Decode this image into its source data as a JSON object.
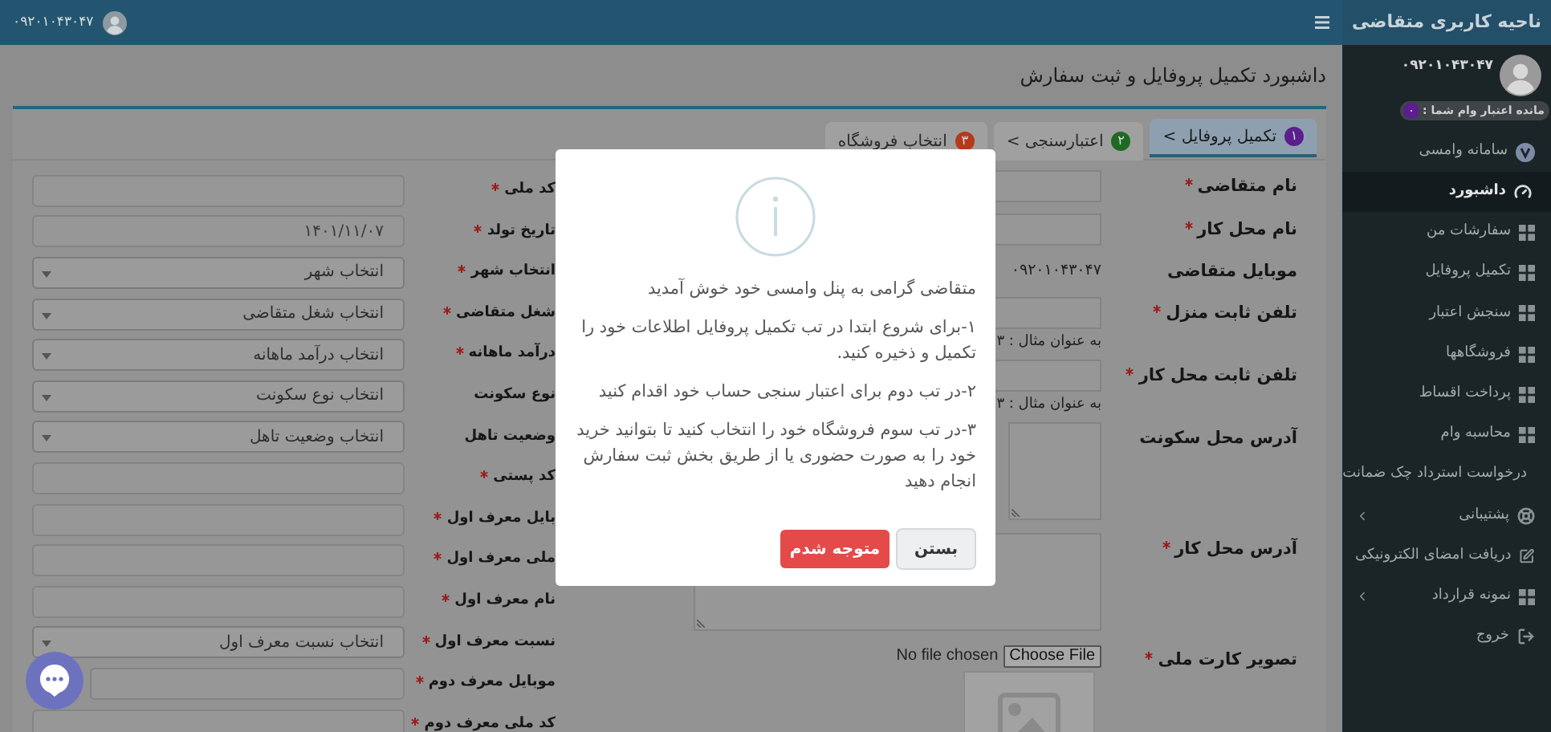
{
  "header": {
    "user_phone": "۰۹۲۰۱۰۴۳۰۴۷"
  },
  "sidebar": {
    "title": "ناحیه کاربری متقاضی",
    "user_phone": "۰۹۲۰۱۰۴۳۰۴۷",
    "credit_label": "مانده اعتبار وام شما :",
    "credit_value": "۰",
    "items": [
      {
        "label": "سامانه وامسی",
        "selected": false,
        "has_submenu": false
      },
      {
        "label": "داشبورد",
        "selected": true,
        "has_submenu": false
      },
      {
        "label": "سفارشات من",
        "selected": false,
        "has_submenu": false
      },
      {
        "label": "تکمیل پروفایل",
        "selected": false,
        "has_submenu": false
      },
      {
        "label": "سنجش اعتبار",
        "selected": false,
        "has_submenu": false
      },
      {
        "label": "فروشگاهها",
        "selected": false,
        "has_submenu": false
      },
      {
        "label": "پرداخت اقساط",
        "selected": false,
        "has_submenu": false
      },
      {
        "label": "محاسبه وام",
        "selected": false,
        "has_submenu": false
      },
      {
        "label": "درخواست استرداد چک ضمانت",
        "selected": false,
        "has_submenu": false
      },
      {
        "label": "پشتیبانی",
        "selected": false,
        "has_submenu": true
      },
      {
        "label": "دریافت امضای الکترونیکی",
        "selected": false,
        "has_submenu": false
      },
      {
        "label": "نمونه قرارداد",
        "selected": false,
        "has_submenu": true
      },
      {
        "label": "خروج",
        "selected": false,
        "has_submenu": false
      }
    ]
  },
  "page_title": "داشبورد تکمیل پروفایل و ثبت سفارش",
  "tabs": [
    {
      "label": "تکمیل پروفایل >",
      "badge": "۱",
      "color": "#5a1f8c",
      "selected": true
    },
    {
      "label": "اعتبارسنجی >",
      "badge": "۲",
      "color": "#1f6a22",
      "selected": false
    },
    {
      "label": "انتخاب فروشگاه",
      "badge": "۳",
      "color": "#b33a1c",
      "selected": false
    }
  ],
  "right_fields": [
    {
      "label": "نام متقاضی",
      "required": true,
      "kind": "input"
    },
    {
      "label": "نام محل کار",
      "required": true,
      "kind": "input"
    },
    {
      "label": "موبایل متقاضی",
      "required": false,
      "kind": "static",
      "value": "۰۹۲۰۱۰۴۳۰۴۷"
    },
    {
      "label": "تلفن ثابت منزل",
      "required": true,
      "kind": "input",
      "hint": "به عنوان مثال : ۳"
    },
    {
      "label": "تلفن ثابت محل کار",
      "required": true,
      "kind": "input",
      "hint": "به عنوان مثال : ۳"
    },
    {
      "label": "آدرس محل سکونت",
      "required": false,
      "kind": "textarea"
    },
    {
      "label": "آدرس محل کار",
      "required": true,
      "kind": "textarea"
    },
    {
      "label": "تصویر کارت ملی",
      "required": true,
      "kind": "file",
      "status": "No file chosen",
      "button": "Choose File"
    }
  ],
  "left_fields": [
    {
      "label": "کد ملی",
      "required": true,
      "kind": "input"
    },
    {
      "label": "تاریخ تولد",
      "required": true,
      "kind": "input",
      "value": "۱۴۰۱/۱۱/۰۷"
    },
    {
      "label": "انتخاب شهر",
      "required": true,
      "kind": "select",
      "value": "انتخاب شهر"
    },
    {
      "label": "شغل متقاضی",
      "required": true,
      "kind": "select",
      "value": "انتخاب شغل متقاضی"
    },
    {
      "label": "درآمد ماهانه",
      "required": true,
      "kind": "select",
      "value": "انتخاب درآمد ماهانه"
    },
    {
      "label": "نوع سکونت",
      "required": false,
      "kind": "select",
      "value": "انتخاب نوع سکونت"
    },
    {
      "label": "وضعیت تاهل",
      "required": false,
      "kind": "select",
      "value": "انتخاب وضعیت تاهل"
    },
    {
      "label": "کد پستی",
      "required": true,
      "kind": "input"
    },
    {
      "label": "بایل معرف اول",
      "required": true,
      "kind": "input"
    },
    {
      "label": "ملی معرف اول",
      "required": true,
      "kind": "input"
    },
    {
      "label": "نام معرف اول",
      "required": true,
      "kind": "input"
    },
    {
      "label": "نسبت معرف اول",
      "required": true,
      "kind": "select",
      "value": "انتخاب نسبت معرف اول"
    },
    {
      "label": "موبایل معرف دوم",
      "required": true,
      "kind": "input"
    },
    {
      "label": "کد ملی معرف دوم",
      "required": true,
      "kind": "input"
    }
  ],
  "modal": {
    "welcome": "متقاضی گرامی به پنل وامسی خود خوش آمدید",
    "steps": [
      "۱-برای شروع ابتدا در تب تکمیل پروفایل اطلاعات خود را تکمیل و ذخیره کنید.",
      "۲-در تب دوم برای اعتبار سنجی حساب خود اقدام کنید",
      "۳-در تب سوم فروشگاه خود را انتخاب کنید تا بتوانید خرید خود را به صورت حضوری یا از طریق بخش ثبت سفارش انجام دهید"
    ],
    "confirm": "متوجه شدم",
    "close": "بستن"
  }
}
